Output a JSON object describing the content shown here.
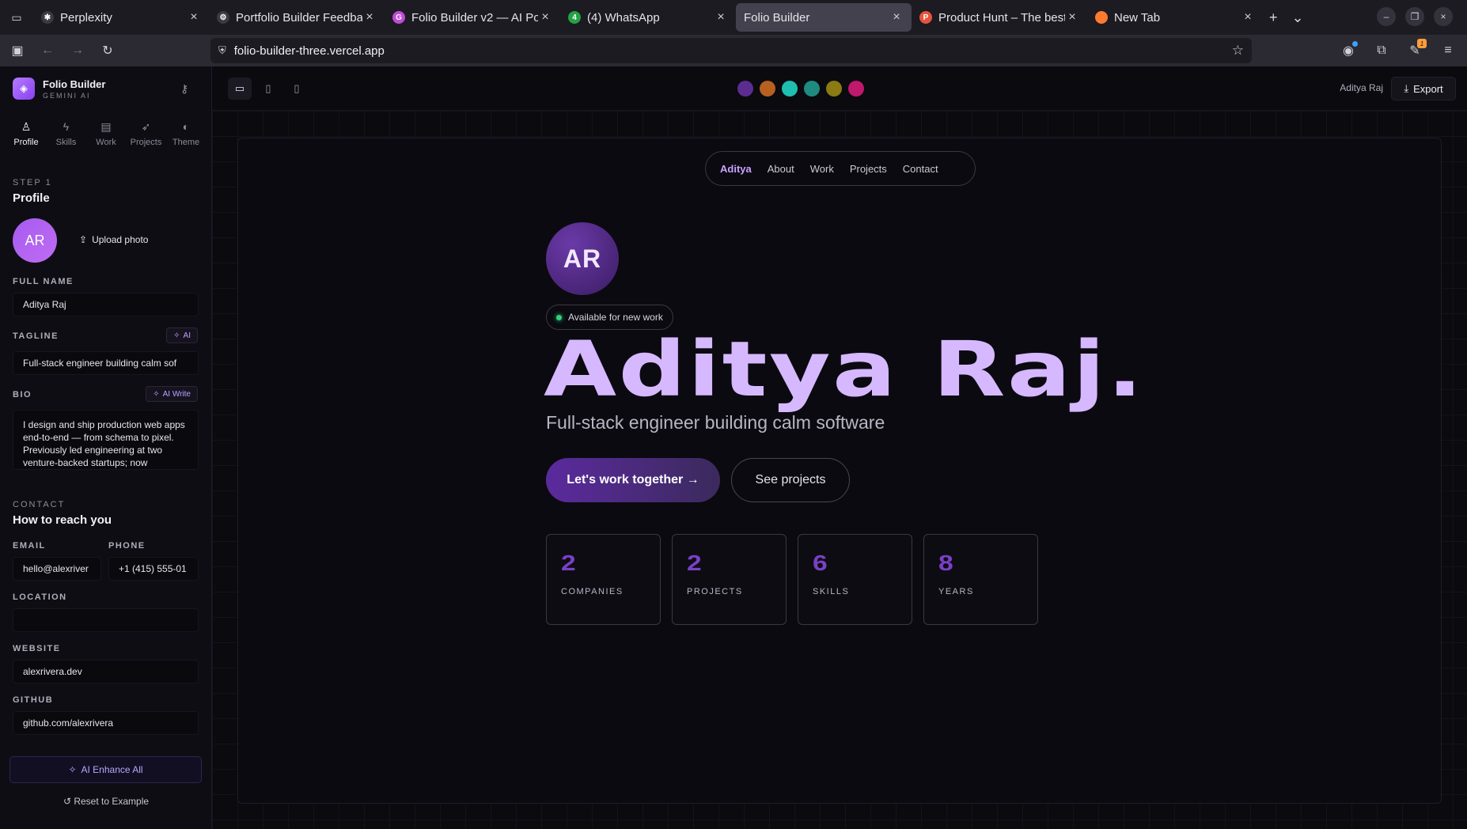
{
  "browser": {
    "tabs": [
      {
        "label": "Perplexity",
        "fav_color": "#3a3a44",
        "fav_glyph": "✱"
      },
      {
        "label": "Portfolio Builder Feedbac",
        "fav_color": "#3a3a44",
        "fav_glyph": "⚙"
      },
      {
        "label": "Folio Builder v2 — AI Port",
        "fav_color": "#c04bd8",
        "fav_glyph": "G"
      },
      {
        "label": "(4) WhatsApp",
        "fav_color": "#25a244",
        "fav_glyph": "4"
      },
      {
        "label": "Folio Builder",
        "fav_color": "",
        "fav_glyph": ""
      },
      {
        "label": "Product Hunt – The best n",
        "fav_color": "#e5533d",
        "fav_glyph": "P"
      },
      {
        "label": "New Tab",
        "fav_color": "#ff7a2e",
        "fav_glyph": "●"
      }
    ],
    "url": "folio-builder-three.vercel.app"
  },
  "sidebar": {
    "brand_name": "Folio Builder",
    "brand_sub": "GEMINI AI",
    "steps": [
      {
        "label": "Profile",
        "icon": "person-icon"
      },
      {
        "label": "Skills",
        "icon": "bolt-icon"
      },
      {
        "label": "Work",
        "icon": "briefcase-icon"
      },
      {
        "label": "Projects",
        "icon": "rocket-icon"
      },
      {
        "label": "Theme",
        "icon": "palette-icon"
      }
    ],
    "step_kicker": "STEP 1",
    "step_title": "Profile",
    "avatar_initials": "AR",
    "upload_label": "Upload photo",
    "full_name_label": "FULL NAME",
    "full_name": "Aditya Raj",
    "tagline_label": "TAGLINE",
    "tagline_ai": "AI",
    "tagline": "Full-stack engineer building calm sof",
    "bio_label": "BIO",
    "bio_ai": "AI Write",
    "bio": "I design and ship production web apps end-to-end — from schema to pixel. Previously led engineering at two venture-backed startups; now",
    "contact_kicker": "CONTACT",
    "contact_title": "How to reach you",
    "email_label": "EMAIL",
    "email": "hello@alexriver",
    "phone_label": "PHONE",
    "phone": "+1 (415) 555-01",
    "location_label": "LOCATION",
    "location": "",
    "website_label": "WEBSITE",
    "website": "alexrivera.dev",
    "github_label": "GITHUB",
    "github": "github.com/alexrivera",
    "enhance_label": "AI Enhance All",
    "reset_label": "Reset to Example"
  },
  "toolbar": {
    "swatches": [
      "#5b2d91",
      "#b8601f",
      "#1fbfb0",
      "#1f8a80",
      "#8c7a12",
      "#c0186c"
    ],
    "user_name": "Aditya Raj",
    "export_label": "Export"
  },
  "preview": {
    "nav_logo": "Aditya",
    "nav_links": [
      "About",
      "Work",
      "Projects",
      "Contact"
    ],
    "avatar_initials": "AR",
    "availability": "Available for new work",
    "name": "Aditya Raj.",
    "tagline": "Full-stack engineer building calm software",
    "cta_primary": "Let's work together →",
    "cta_secondary": "See projects",
    "stats": [
      {
        "value": "2",
        "label": "COMPANIES"
      },
      {
        "value": "2",
        "label": "PROJECTS"
      },
      {
        "value": "6",
        "label": "SKILLS"
      },
      {
        "value": "8",
        "label": "YEARS"
      }
    ]
  }
}
